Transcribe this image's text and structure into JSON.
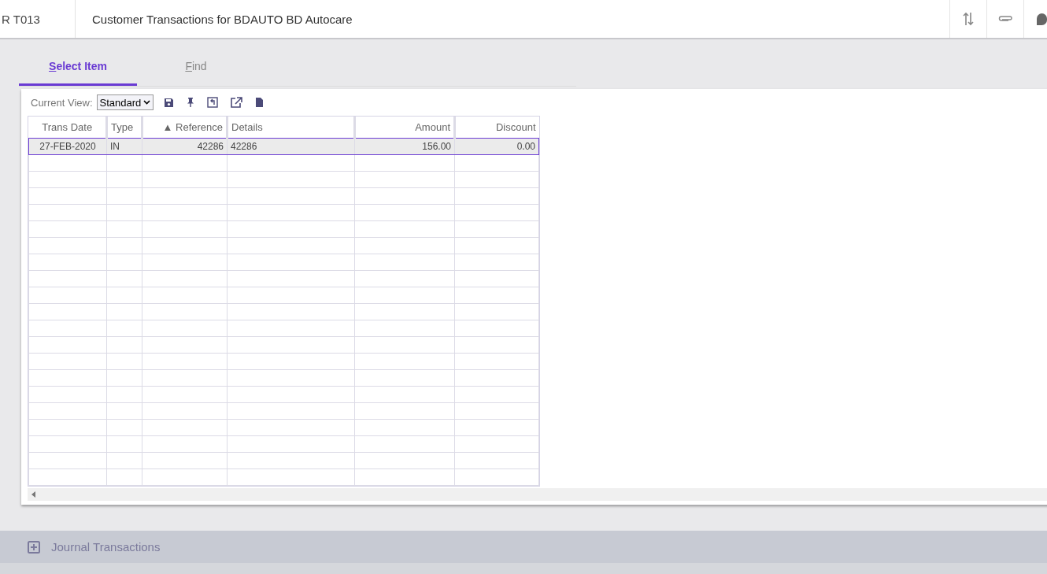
{
  "header": {
    "code": "R T013",
    "title": "Customer Transactions for BDAUTO BD Autocare"
  },
  "tabs": [
    {
      "label": "Select Item",
      "selected": true
    },
    {
      "label": "Find",
      "selected": false
    }
  ],
  "toolbar": {
    "view_label": "Current View:",
    "view_value": "Standard"
  },
  "table": {
    "columns": [
      {
        "label": "Trans Date"
      },
      {
        "label": "Type"
      },
      {
        "label": "Reference",
        "sort_mark": "▲"
      },
      {
        "label": "Details"
      },
      {
        "label": "Amount"
      },
      {
        "label": "Discount"
      }
    ],
    "rows": [
      {
        "selected": true,
        "cells": [
          "27-FEB-2020",
          "IN",
          "42286",
          "42286",
          "156.00",
          "0.00"
        ]
      }
    ]
  },
  "section": {
    "label": "Journal Transactions",
    "expanded": false
  }
}
